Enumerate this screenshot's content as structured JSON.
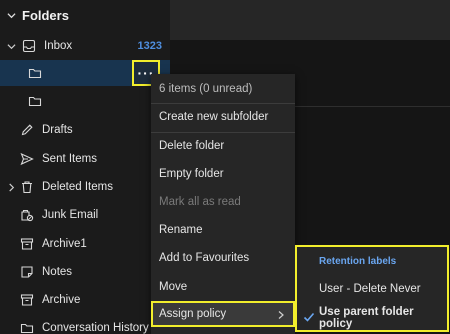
{
  "sidebar": {
    "title": "Folders",
    "inbox": {
      "label": "Inbox",
      "count": "1323"
    },
    "items": [
      {
        "label": "Drafts",
        "icon": "pencil-icon"
      },
      {
        "label": "Sent Items",
        "icon": "send-icon"
      },
      {
        "label": "Deleted Items",
        "icon": "trash-icon"
      },
      {
        "label": "Junk Email",
        "icon": "junk-icon"
      },
      {
        "label": "Archive1",
        "icon": "archive-icon"
      },
      {
        "label": "Notes",
        "icon": "note-icon"
      },
      {
        "label": "Archive",
        "icon": "archive-icon"
      },
      {
        "label": "Conversation History",
        "icon": "folder-icon"
      }
    ],
    "more_button": "···"
  },
  "context_menu": {
    "status": "6 items (0 unread)",
    "items": [
      {
        "label": "Create new subfolder"
      },
      {
        "label": "Delete folder"
      },
      {
        "label": "Empty folder"
      },
      {
        "label": "Mark all as read"
      },
      {
        "label": "Rename"
      },
      {
        "label": "Add to Favourites"
      },
      {
        "label": "Move"
      },
      {
        "label": "Assign policy"
      }
    ]
  },
  "submenu": {
    "header": "Retention labels",
    "options": [
      {
        "label": "User - Delete Never"
      },
      {
        "label": "Use parent folder policy"
      }
    ]
  },
  "colors": {
    "highlight": "#f2ee2c",
    "accent": "#4f8fe0",
    "selected": "#18344f"
  }
}
